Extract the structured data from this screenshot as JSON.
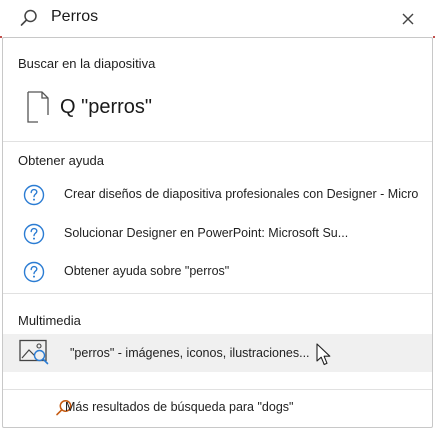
{
  "search": {
    "query": "Perros"
  },
  "sections": {
    "slide": {
      "header": "Buscar en la diapositiva",
      "item": "Q \"perros\""
    },
    "help": {
      "header": "Obtener ayuda",
      "items": [
        "Crear diseños de diapositiva profesionales con Designer - Micro",
        "Solucionar Designer en PowerPoint: Microsoft Su...",
        "Obtener ayuda sobre \"perros\""
      ]
    },
    "media": {
      "header": "Multimedia",
      "item": "\"perros\" - imágenes, iconos, ilustraciones..."
    },
    "more": {
      "label": "Más resultados de búsqueda para \"dogs\""
    }
  },
  "colors": {
    "accent": "#2b7cd3",
    "more_icon": "#c55a11",
    "highlight": "#f0f0f0"
  },
  "icons": {
    "search": "search-icon",
    "close": "close-icon",
    "slide_search": "document-search-icon",
    "help": "help-circle-icon",
    "media": "image-search-icon",
    "more": "search-icon"
  }
}
